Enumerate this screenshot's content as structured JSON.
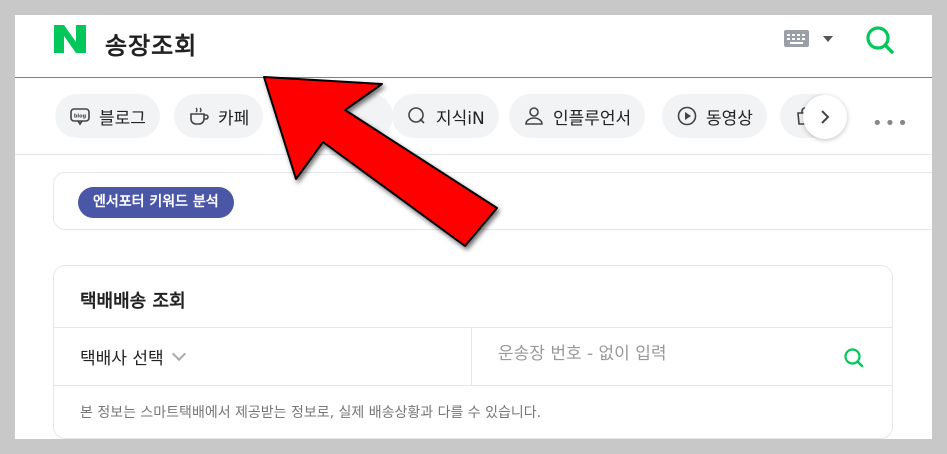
{
  "header": {
    "title": "송장조회",
    "logo_letter": "N",
    "brand_color": "#03c75a"
  },
  "tabs": [
    {
      "label": "블로그",
      "icon": "blog-icon"
    },
    {
      "label": "카페",
      "icon": "cafe-icon"
    },
    {
      "label": "",
      "icon": "image-icon"
    },
    {
      "label": "지식iN",
      "icon": "kin-icon"
    },
    {
      "label": "인플루언서",
      "icon": "person-icon"
    },
    {
      "label": "동영상",
      "icon": "play-icon"
    },
    {
      "label": "",
      "icon": "shopping-icon"
    }
  ],
  "keyword": {
    "badge": "엔서포터 키워드 분석",
    "badge_color": "#4a56a6"
  },
  "tracking": {
    "title": "택배배송 조회",
    "carrier_select": "택배사 선택",
    "invoice_placeholder": "운송장 번호 - 없이 입력",
    "notice": "본 정보는 스마트택배에서 제공받는 정보로, 실제 배송상황과 다를 수 있습니다."
  },
  "overlay": {
    "arrow_color": "#ff0000"
  }
}
